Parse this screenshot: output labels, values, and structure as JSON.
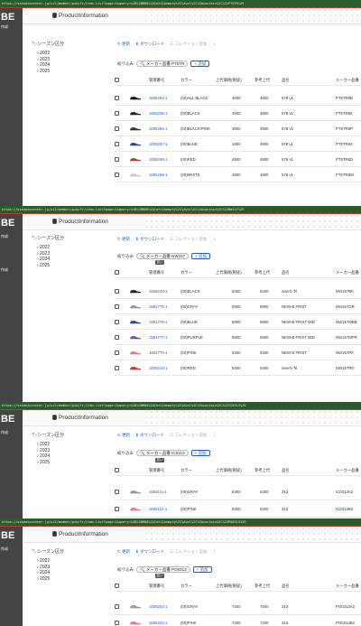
{
  "app": {
    "brand_fragment": "BE",
    "title": "ProductInformation",
    "sidebar_fragment": "作成"
  },
  "season": {
    "label": "シーズン区分",
    "years": [
      "2022",
      "2023",
      "2024",
      "2025"
    ]
  },
  "toolbar": {
    "refresh": "更新",
    "download": "ダウンロード",
    "collection": "コレクション追加"
  },
  "filter": {
    "label": "絞り込み",
    "add": "追加"
  },
  "columns": [
    "管理番号",
    "カラー",
    "上代価格(税抜)",
    "参考上代",
    "品名",
    "メーカー品番"
  ],
  "tooltip": "並い",
  "shots": [
    {
      "url": "https://sskdatacenter.jp/ui2/member/pim/fr/item-list?page=1&query=%2B%2BMD0%2ACat%2Aempty%2C%Aval%2C%3Acontain%2C%22PT5TR%29",
      "chip": "メーカー品番 PT5TR",
      "rows": [
        {
          "id": "1606264-1",
          "color": "(00)ALL BLACK",
          "price": "4900",
          "ref": "4900",
          "name": "578 v1",
          "maker": "PT5TR8B"
        },
        {
          "id": "1606265-1",
          "color": "(00)BLACK",
          "price": "4900",
          "ref": "4900",
          "name": "578 v1",
          "maker": "PT5TR8K"
        },
        {
          "id": "1606266-1",
          "color": "(00)BLACK/PINK",
          "price": "4900",
          "ref": "4900",
          "name": "578 v1",
          "maker": "PT5TR8P"
        },
        {
          "id": "1606267-1",
          "color": "(00)BLUE",
          "price": "4900",
          "ref": "4900",
          "name": "578 v1",
          "maker": "PT5TR8S"
        },
        {
          "id": "1606268-1",
          "color": "(00)RED",
          "price": "4900",
          "ref": "4900",
          "name": "578 v1",
          "maker": "PT5TR8D"
        },
        {
          "id": "1606269-1",
          "color": "(00)WHITE",
          "price": "4900",
          "ref": "4900",
          "name": "578 v1",
          "maker": "PT5TR8W"
        }
      ]
    },
    {
      "url": "https://sskdatacenter.jp/ui2/member/pim/fr/item-list?page=1&query=%2B%2BMD0%2ACat%2Aempty%2C%Aval%2C%3Acontain%2C%22NW157%29",
      "chip": "メーカー品番 NW157",
      "rows": [
        {
          "id": "1606244-1",
          "color": "(00)BLACK",
          "price": "5400",
          "ref": "5400",
          "name": "new-b 'hl",
          "maker": "NW157BK"
        },
        {
          "id": "1591776-1",
          "color": "(00)GRAY",
          "price": "5900",
          "ref": "5900",
          "name": "NEW-B FIRST",
          "maker": "NW157GR"
        },
        {
          "id": "1591776-1",
          "color": "(00)BLUE",
          "price": "5900",
          "ref": "5900",
          "name": "NEW-B FIRST MID",
          "maker": "NW157MBB"
        },
        {
          "id": "1591777-1",
          "color": "(00)PURPLE",
          "price": "5900",
          "ref": "5900",
          "name": "NEW-B FIRST MID",
          "maker": "NW157MPR"
        },
        {
          "id": "1591779-1",
          "color": "(00)PINK",
          "price": "5400",
          "ref": "5400",
          "name": "NEW-B FIRST",
          "maker": "NW157PK"
        },
        {
          "id": "1606243-1",
          "color": "(00)RED",
          "price": "5400",
          "ref": "5400",
          "name": "new-b 'hl",
          "maker": "NW157RD"
        }
      ]
    },
    {
      "url": "https://sskdatacenter.jp/ui2/member/pim/fr/item-list?page=1&query=%2B%2BMD0%2ACat%2Aempty%2C%Aval%2C%3Acontain%2C%22IC0313%29",
      "chip": "メーカー品番 IC0313",
      "rows": [
        {
          "id": "1606111-1",
          "color": "(00)GRAY",
          "price": "6300",
          "ref": "6300",
          "name": "313",
          "maker": "IC0313A2"
        },
        {
          "id": "1606112-1",
          "color": "(00)PINK",
          "price": "6300",
          "ref": "6300",
          "name": "313",
          "maker": "IC0313B2"
        }
      ]
    },
    {
      "url": "https://sskdatacenter.jp/ui2/member/pim/fr/item-list?page=1&query=%2B%2BMD0%2ACat%2Aempty%2C%Aval%2C%3Acontain%2C%22PO0313%29",
      "chip": "メーカー品番 PO0313",
      "rows": [
        {
          "id": "1606262-1",
          "color": "(00)GRAY",
          "price": "7200",
          "ref": "7200",
          "name": "313",
          "maker": "PO0313A2"
        },
        {
          "id": "1606263-1",
          "color": "(00)PINK",
          "price": "7200",
          "ref": "7200",
          "name": "313",
          "maker": "PO0313B2"
        }
      ]
    }
  ]
}
